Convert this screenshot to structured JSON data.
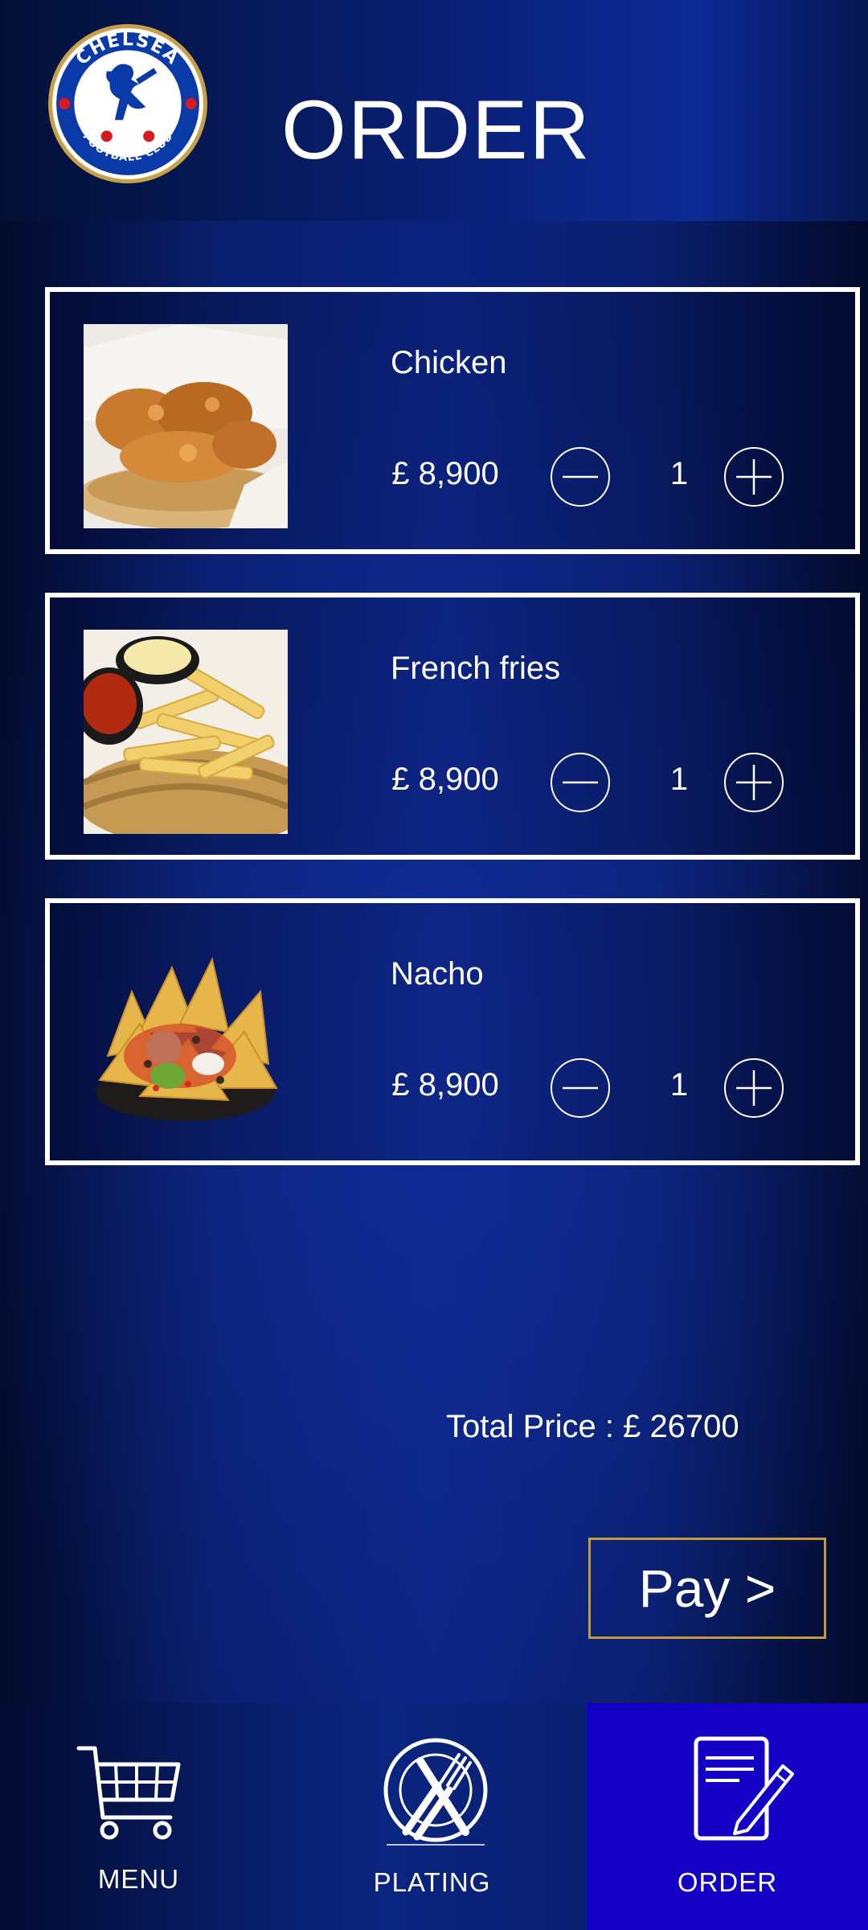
{
  "header": {
    "title": "ORDER",
    "logo": {
      "text_top": "CHELSEA",
      "text_bottom": "FOOTBALL CLUB",
      "colors": {
        "ring": "#c8a04a",
        "blue": "#0a3aa8",
        "red": "#d71920"
      }
    }
  },
  "items": [
    {
      "name": "Chicken",
      "price": "£ 8,900",
      "qty": "1",
      "image": "fried-chicken"
    },
    {
      "name": "French fries",
      "price": "£ 8,900",
      "qty": "1",
      "image": "french-fries"
    },
    {
      "name": "Nacho",
      "price": "£ 8,900",
      "qty": "1",
      "image": "nachos"
    }
  ],
  "total": "Total Price : £ 26700",
  "pay_label": "Pay >",
  "nav": [
    {
      "label": "MENU",
      "icon": "cart-icon",
      "active": false
    },
    {
      "label": "PLATING",
      "icon": "plate-icon",
      "active": false
    },
    {
      "label": "ORDER",
      "icon": "order-note-icon",
      "active": true
    }
  ],
  "colors": {
    "active_nav": "#1400c4",
    "pay_border": "#c59a3a",
    "card_border": "#ffffff"
  }
}
